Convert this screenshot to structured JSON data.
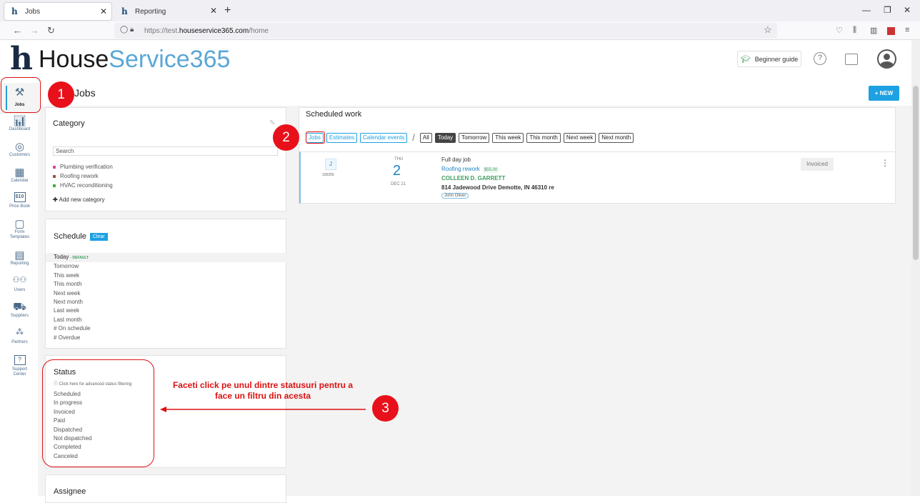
{
  "browser": {
    "tabs": [
      {
        "label": "Jobs",
        "active": true
      },
      {
        "label": "Reporting",
        "active": false
      }
    ],
    "url_prefix": "https://test.",
    "url_domain": "houseservice365.com",
    "url_path": "/home"
  },
  "header": {
    "logo_part1": "House",
    "logo_part2": "Service365",
    "beginner_guide": "Beginner guide"
  },
  "sidebar": {
    "items": [
      {
        "label": "Jobs",
        "icon": "tools-icon"
      },
      {
        "label": "Dashboard",
        "icon": "bar-chart-icon"
      },
      {
        "label": "Customers",
        "icon": "customers-icon"
      },
      {
        "label": "Calendar",
        "icon": "calendar-icon"
      },
      {
        "label": "Price Book",
        "icon": "price-book-icon"
      },
      {
        "label": "Form Templates",
        "icon": "form-icon"
      },
      {
        "label": "Reporting",
        "icon": "report-icon"
      },
      {
        "label": "Users",
        "icon": "users-icon"
      },
      {
        "label": "Suppliers",
        "icon": "truck-icon"
      },
      {
        "label": "Partners",
        "icon": "partners-icon"
      },
      {
        "label": "Support Center",
        "icon": "support-icon"
      }
    ],
    "price_book_glyph": "$10"
  },
  "page": {
    "title": "Jobs",
    "new_button": "+ NEW"
  },
  "category": {
    "title": "Category",
    "search_placeholder": "Search",
    "items": [
      {
        "label": "Plumbing verification",
        "color": "#e040a0"
      },
      {
        "label": "Roofing rework",
        "color": "#a0522d"
      },
      {
        "label": "HVAC reconditioning",
        "color": "#3cb043"
      }
    ],
    "add": "Add new category"
  },
  "schedule": {
    "title": "Schedule",
    "clear": "Clear",
    "items": [
      "Today",
      "Tomorrow",
      "This week",
      "This month",
      "Next week",
      "Next month",
      "Last week",
      "Last month",
      "# On schedule",
      "# Overdue"
    ],
    "default_tag": "- DEFAULT"
  },
  "status": {
    "title": "Status",
    "hint": "ⓘ Click here for advanced status filtering",
    "items": [
      "Scheduled",
      "In progress",
      "Invoiced",
      "Paid",
      "Dispatched",
      "Not dispatched",
      "Completed",
      "Canceled"
    ]
  },
  "assignee": {
    "title": "Assignee"
  },
  "scheduled_work": {
    "title": "Scheduled work",
    "type_filters": [
      "Jobs",
      "Estimates",
      "Calendar events"
    ],
    "range_filters": [
      "All",
      "Today",
      "Tomorrow",
      "This week",
      "This month",
      "Next week",
      "Next month"
    ],
    "active_range": "Today",
    "job": {
      "badge": "J",
      "number": "100255",
      "dow": "THU",
      "day": "2",
      "month": "DEC 21",
      "title": "Full day job",
      "category": "Roofing rework",
      "price": "$55.00",
      "customer": "COLLEEN D. GARRETT",
      "address": "814 Jadewood Drive Demotte, IN 46310 re",
      "technician": "John Oliver",
      "status": "Invoiced"
    }
  },
  "annotations": {
    "step1": "1",
    "step2": "2",
    "step3": "3",
    "step3_text": "Faceti click pe unul dintre statusuri pentru a face un filtru din acesta",
    "color": "#e8101a"
  }
}
